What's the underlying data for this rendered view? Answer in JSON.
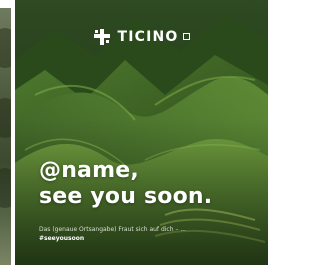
{
  "ad": {
    "brand": "TICINO",
    "headline_line1": "@name,",
    "headline_line2": "see you soon.",
    "caption": "Das (genaue Ortsangabe) Fraut sich auf dich – ...",
    "hashtag": "#seeyousoon"
  },
  "icons": {
    "brand_logo": "ticino-logo-icon"
  }
}
